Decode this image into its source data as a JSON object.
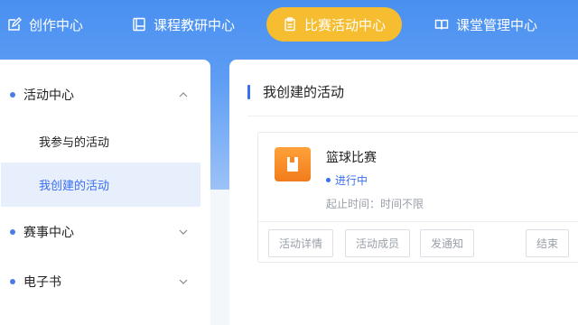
{
  "nav": {
    "items": [
      {
        "label": "创作中心",
        "icon": "edit-icon",
        "active": false
      },
      {
        "label": "课程教研中心",
        "icon": "book-icon",
        "active": false
      },
      {
        "label": "比赛活动中心",
        "icon": "clipboard-icon",
        "active": true
      },
      {
        "label": "课堂管理中心",
        "icon": "open-book-icon",
        "active": false
      }
    ]
  },
  "sidebar": {
    "groups": [
      {
        "label": "活动中心",
        "expanded": true,
        "items": [
          {
            "label": "我参与的活动",
            "active": false
          },
          {
            "label": "我创建的活动",
            "active": true
          }
        ]
      },
      {
        "label": "赛事中心",
        "expanded": false
      },
      {
        "label": "电子书",
        "expanded": false
      }
    ]
  },
  "main": {
    "title": "我创建的活动",
    "card": {
      "name": "篮球比赛",
      "status": "进行中",
      "time": "起止时间：时间不限",
      "icon": "book-icon",
      "buttons": [
        "活动详情",
        "活动成员",
        "发通知",
        "结束"
      ]
    }
  },
  "colors": {
    "accent": "#3a6ff0",
    "nav_active": "#f5bd2f",
    "card_icon": "#f58a22"
  }
}
